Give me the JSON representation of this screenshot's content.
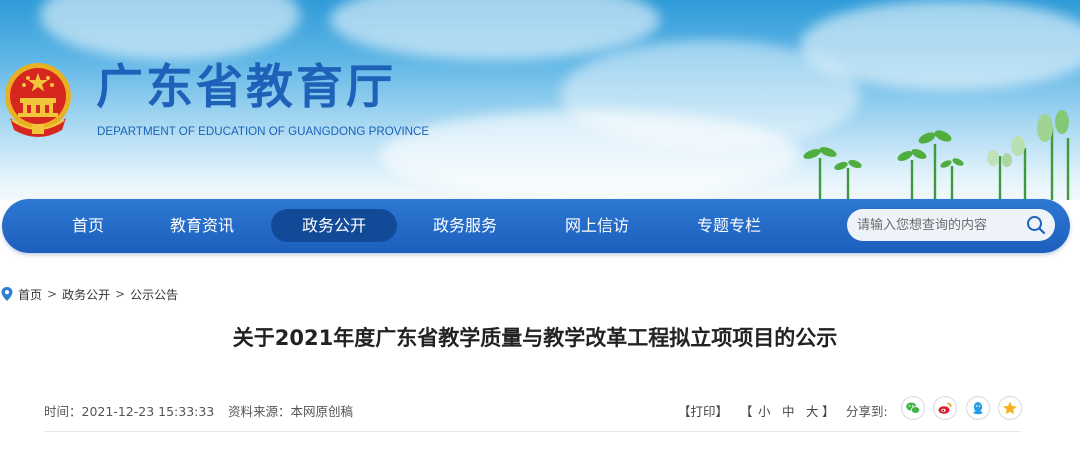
{
  "header": {
    "title": "广东省教育厅",
    "subtitle": "DEPARTMENT OF EDUCATION OF GUANGDONG PROVINCE"
  },
  "nav": {
    "items": [
      {
        "label": "首页",
        "active": false
      },
      {
        "label": "教育资讯",
        "active": false
      },
      {
        "label": "政务公开",
        "active": true
      },
      {
        "label": "政务服务",
        "active": false
      },
      {
        "label": "网上信访",
        "active": false
      },
      {
        "label": "专题专栏",
        "active": false
      }
    ],
    "search": {
      "placeholder": "请输入您想查询的内容",
      "icon": "search-icon"
    }
  },
  "breadcrumb": {
    "icon": "location-pin-icon",
    "separator": ">",
    "items": [
      "首页",
      "政务公开",
      "公示公告"
    ]
  },
  "article": {
    "title": "关于2021年度广东省教学质量与教学改革工程拟立项项目的公示",
    "time_label": "时间：2021-12-23 15:33:33",
    "source_label": "资料来源：本网原创稿",
    "tools": {
      "print": "【打印】",
      "font_open": "【",
      "font_small": "小",
      "font_medium": "中",
      "font_large": "大",
      "font_close": "】"
    },
    "share": {
      "label": "分享到:",
      "buttons": [
        "wechat-icon",
        "weibo-icon",
        "qq-icon",
        "qzone-icon"
      ]
    }
  },
  "colors": {
    "brand_blue": "#1d62b8",
    "nav_blue": "#1c5fbd",
    "nav_active": "#134a98"
  }
}
